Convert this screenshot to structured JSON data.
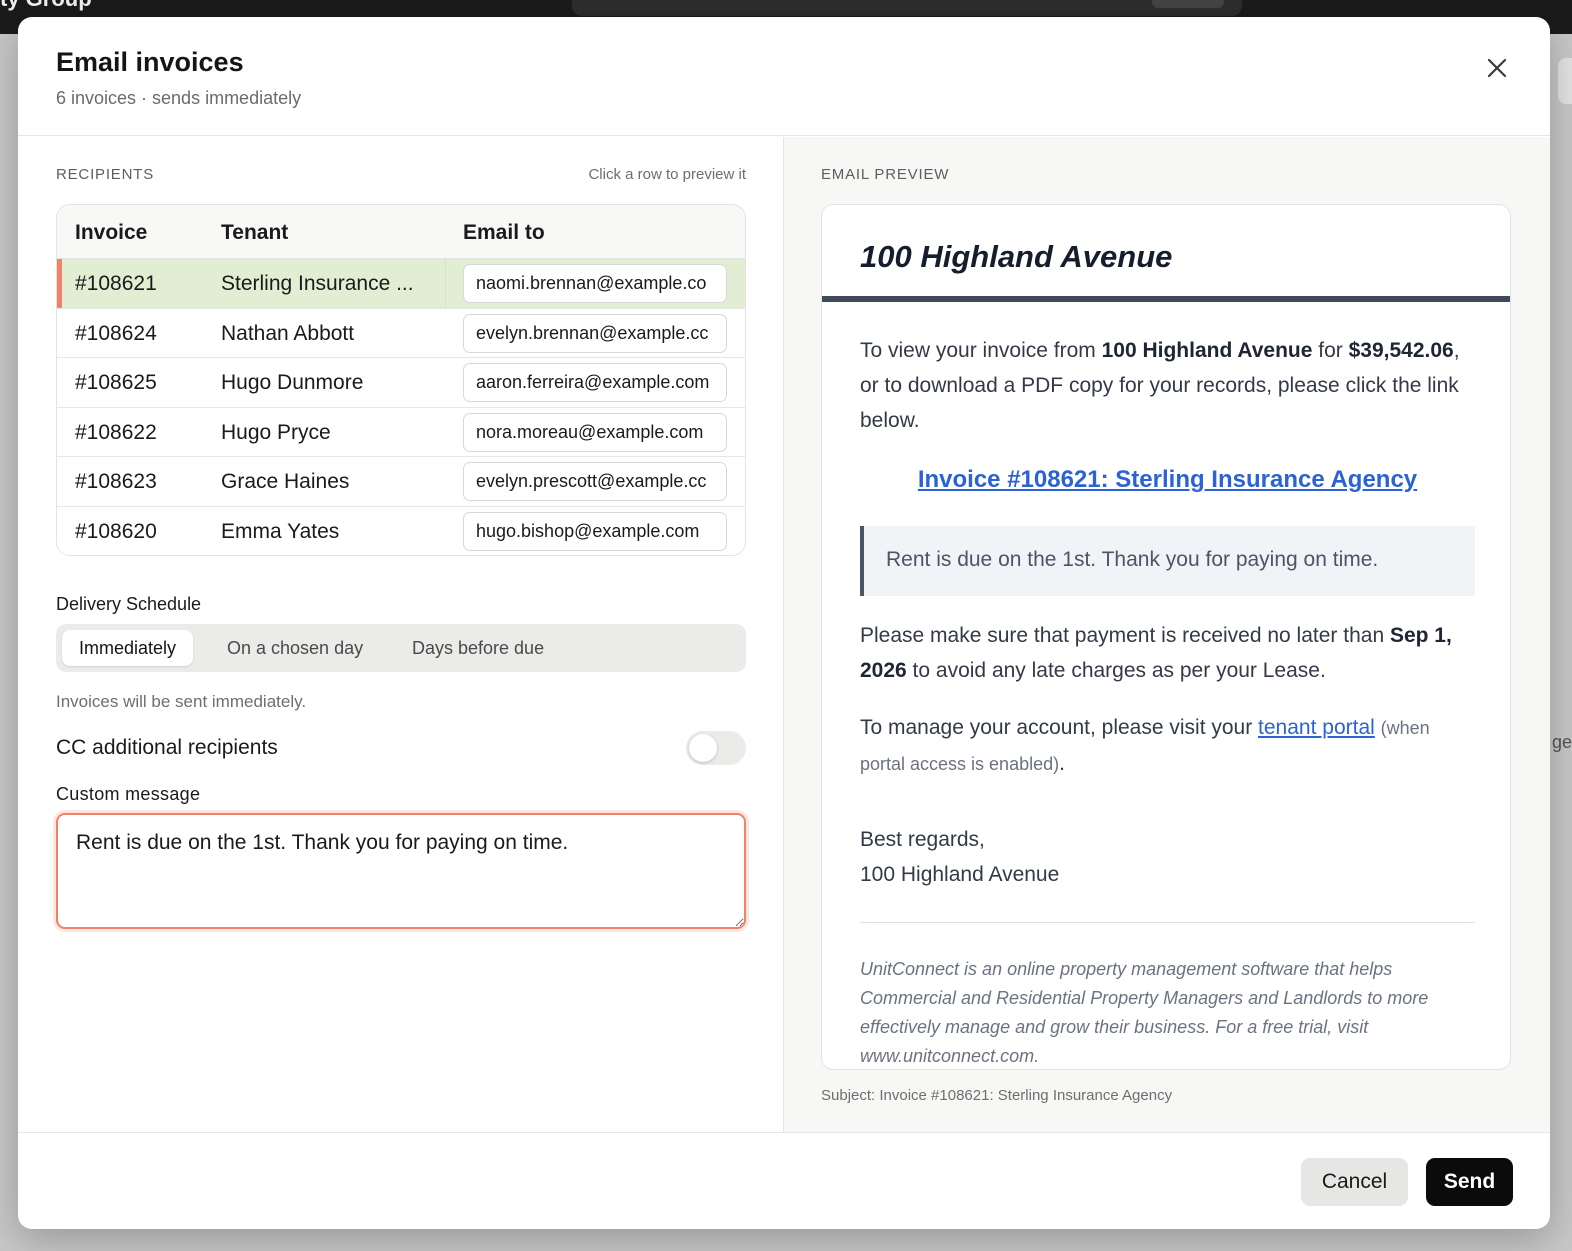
{
  "backdrop": {
    "app_title": "ty Group",
    "edge_text": "ge"
  },
  "modal": {
    "title": "Email invoices",
    "subtitle": "6 invoices · sends immediately"
  },
  "recipients": {
    "section_label": "RECIPIENTS",
    "hint": "Click a row to preview it",
    "columns": {
      "invoice": "Invoice",
      "tenant": "Tenant",
      "email": "Email to"
    },
    "rows": [
      {
        "invoice": "#108621",
        "tenant": "Sterling Insurance ...",
        "email": "naomi.brennan@example.co",
        "selected": true
      },
      {
        "invoice": "#108624",
        "tenant": "Nathan Abbott",
        "email": "evelyn.brennan@example.cc"
      },
      {
        "invoice": "#108625",
        "tenant": "Hugo Dunmore",
        "email": "aaron.ferreira@example.com"
      },
      {
        "invoice": "#108622",
        "tenant": "Hugo Pryce",
        "email": "nora.moreau@example.com"
      },
      {
        "invoice": "#108623",
        "tenant": "Grace Haines",
        "email": "evelyn.prescott@example.cc"
      },
      {
        "invoice": "#108620",
        "tenant": "Emma Yates",
        "email": "hugo.bishop@example.com"
      }
    ]
  },
  "delivery": {
    "label": "Delivery Schedule",
    "options": [
      "Immediately",
      "On a chosen day",
      "Days before due"
    ],
    "selected": "Immediately",
    "note": "Invoices will be sent immediately."
  },
  "cc": {
    "label": "CC additional recipients",
    "enabled": false
  },
  "custom_message": {
    "label": "Custom message",
    "value": "Rent is due on the 1st. Thank you for paying on time."
  },
  "preview": {
    "section_label": "EMAIL PREVIEW",
    "property": "100 Highland Avenue",
    "intro_1": "To view your invoice from ",
    "intro_property": "100 Highland Avenue",
    "intro_2": " for ",
    "amount": "$39,542.06",
    "intro_3": ", or to download a PDF copy for your records, please click the link below.",
    "link_text": "Invoice #108621: Sterling Insurance Agency",
    "quote": "Rent is due on the 1st. Thank you for paying on time.",
    "due_1": "Please make sure that payment is received no later than ",
    "due_date": "Sep 1, 2026",
    "due_2": " to avoid any late charges as per your Lease.",
    "manage_1": "To manage your account, please visit your ",
    "manage_link": "tenant portal",
    "manage_note": "(when portal access is enabled)",
    "manage_end": ".",
    "regards": "Best regards,",
    "signature": "100 Highland Avenue",
    "footer": "UnitConnect is an online property management software that helps Commercial and Residential Property Managers and Landlords to more effectively manage and grow their business. For a free trial, visit www.unitconnect.com.",
    "subject": "Subject: Invoice #108621: Sterling Insurance Agency"
  },
  "footer": {
    "cancel_label": "Cancel",
    "send_label": "Send"
  },
  "colors": {
    "accent": "#f0826b",
    "selected_row": "#e1eed4",
    "link": "#2b63d6",
    "primary_button": "#0b0b0b"
  }
}
